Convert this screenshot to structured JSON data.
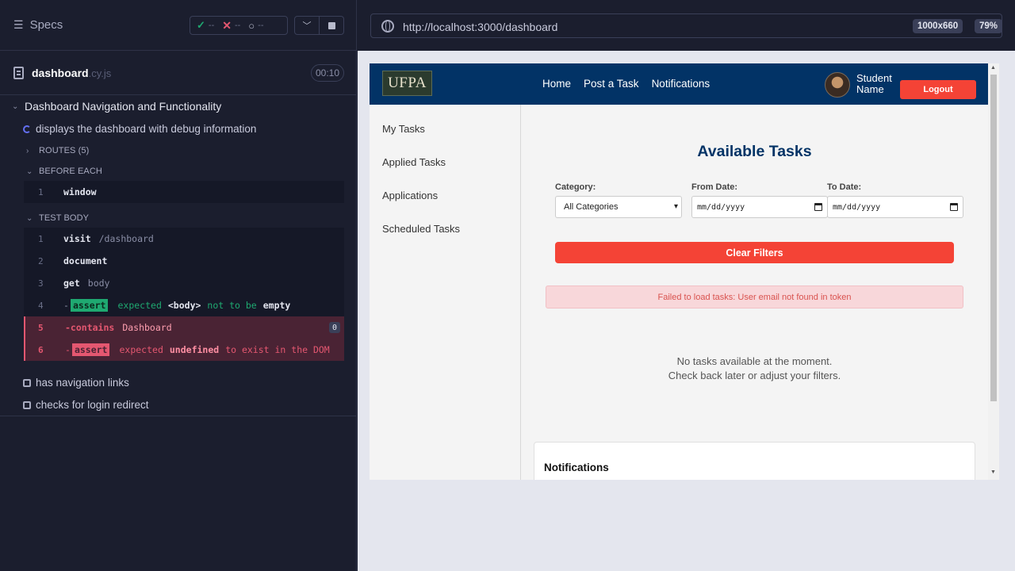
{
  "reporter": {
    "specs_label": "Specs",
    "stats": {
      "passed": "--",
      "failed": "--",
      "pending": "--"
    },
    "spec_file": {
      "name": "dashboard",
      "ext": ".cy.js",
      "duration": "00:10"
    },
    "suite_title": "Dashboard Navigation and Functionality",
    "test_title": "displays the dashboard with debug information",
    "routes_label": "ROUTES (5)",
    "before_each_label": "BEFORE EACH",
    "before_each_cmds": [
      {
        "num": "1",
        "name": "window"
      }
    ],
    "test_body_label": "TEST BODY",
    "commands": [
      {
        "num": "1",
        "name": "visit",
        "msg": "/dashboard"
      },
      {
        "num": "2",
        "name": "document",
        "msg": ""
      },
      {
        "num": "3",
        "name": "get",
        "msg": "body"
      },
      {
        "num": "4",
        "badge": "assert",
        "parts": [
          "expected",
          "<body>",
          "not to be",
          "empty"
        ]
      },
      {
        "num": "5",
        "name": "-contains",
        "msg": "Dashboard",
        "count": "0"
      },
      {
        "num": "6",
        "badge": "assert",
        "parts": [
          "expected",
          "undefined",
          "to exist in the DOM"
        ]
      }
    ],
    "pending_tests": [
      "has navigation links",
      "checks for login redirect"
    ]
  },
  "aut": {
    "url": "http://localhost:3000/dashboard",
    "viewport": "1000x660",
    "zoom": "79%",
    "app": {
      "logo": "UFPA",
      "nav_links": [
        "Home",
        "Post a Task",
        "Notifications"
      ],
      "user_name_line1": "Student",
      "user_name_line2": "Name",
      "logout": "Logout",
      "sidebar": [
        "My Tasks",
        "Applied Tasks",
        "Applications",
        "Scheduled Tasks"
      ],
      "title": "Available Tasks",
      "filters": {
        "category_label": "Category:",
        "category_value": "All Categories",
        "from_label": "From Date:",
        "from_placeholder": "mm/dd/yyyy",
        "to_label": "To Date:",
        "to_placeholder": "mm/dd/yyyy"
      },
      "clear_filters": "Clear Filters",
      "error": "Failed to load tasks: User email not found in token",
      "empty_line1": "No tasks available at the moment.",
      "empty_line2": "Check back later or adjust your filters.",
      "notifications_title": "Notifications"
    }
  },
  "colors": {
    "reporter_bg": "#1b1e2e",
    "passed": "#1fa971",
    "failed": "#e45770",
    "nav_bg": "#023366",
    "danger": "#f44336"
  }
}
